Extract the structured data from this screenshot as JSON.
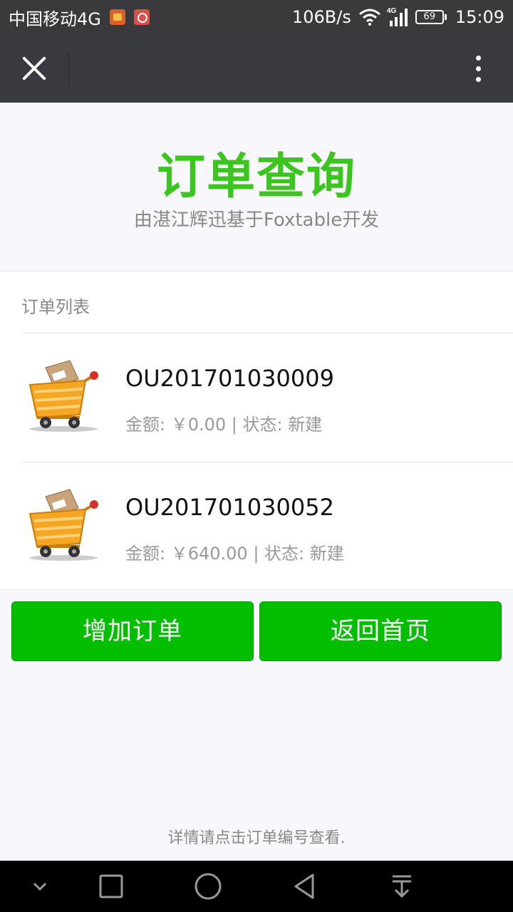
{
  "status_bar": {
    "carrier": "中国移动4G",
    "net_speed": "106B/s",
    "signal_type": "4G",
    "battery": "69",
    "time": "15:09"
  },
  "title_bar": {
    "close_icon": "close-icon",
    "more_icon": "more-vertical-icon"
  },
  "header": {
    "title": "订单查询",
    "subtitle": "由湛江辉迅基于Foxtable开发"
  },
  "order_list": {
    "header": "订单列表",
    "items": [
      {
        "order_no": "OU201701030009",
        "meta": "金额: ￥0.00 | 状态: 新建",
        "icon": "shopping-cart-icon"
      },
      {
        "order_no": "OU201701030052",
        "meta": "金额: ￥640.00 | 状态: 新建",
        "icon": "shopping-cart-icon"
      }
    ]
  },
  "buttons": {
    "add_order": "增加订单",
    "back_home": "返回首页"
  },
  "footer": {
    "tip": "详情请点击订单编号查看."
  },
  "colors": {
    "accent": "#3cc51f",
    "button": "#04be02",
    "title_bar": "#393a3f"
  }
}
